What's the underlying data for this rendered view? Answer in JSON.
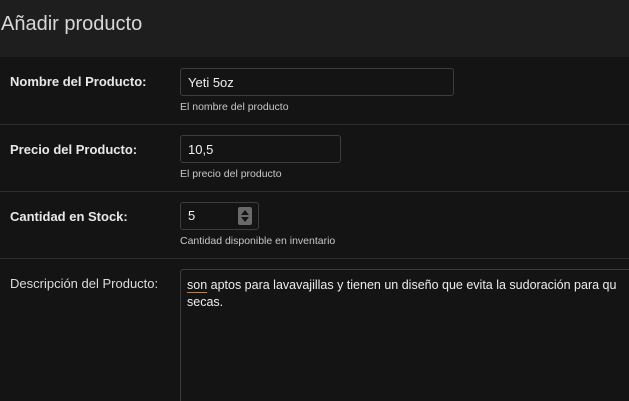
{
  "page": {
    "title": "Añadir producto"
  },
  "form": {
    "name": {
      "label": "Nombre del Producto:",
      "value": "Yeti 5oz",
      "help": "El nombre del producto"
    },
    "price": {
      "label": "Precio del Producto:",
      "value": "10,5",
      "help": "El precio del producto"
    },
    "stock": {
      "label": "Cantidad en Stock:",
      "value": "5",
      "help": "Cantidad disponible en inventario"
    },
    "description": {
      "label": "Descripción del Producto:",
      "first_word": "son",
      "line1_rest": " aptos para lavavajillas y tienen un diseño que evita la sudoración para qu",
      "line2": "secas."
    }
  },
  "icons": {
    "stepper": "spinner-arrows-icon"
  },
  "colors": {
    "background": "#1e1e1e",
    "panel": "#141414",
    "spellcheck_underline": "#d07a2c"
  }
}
